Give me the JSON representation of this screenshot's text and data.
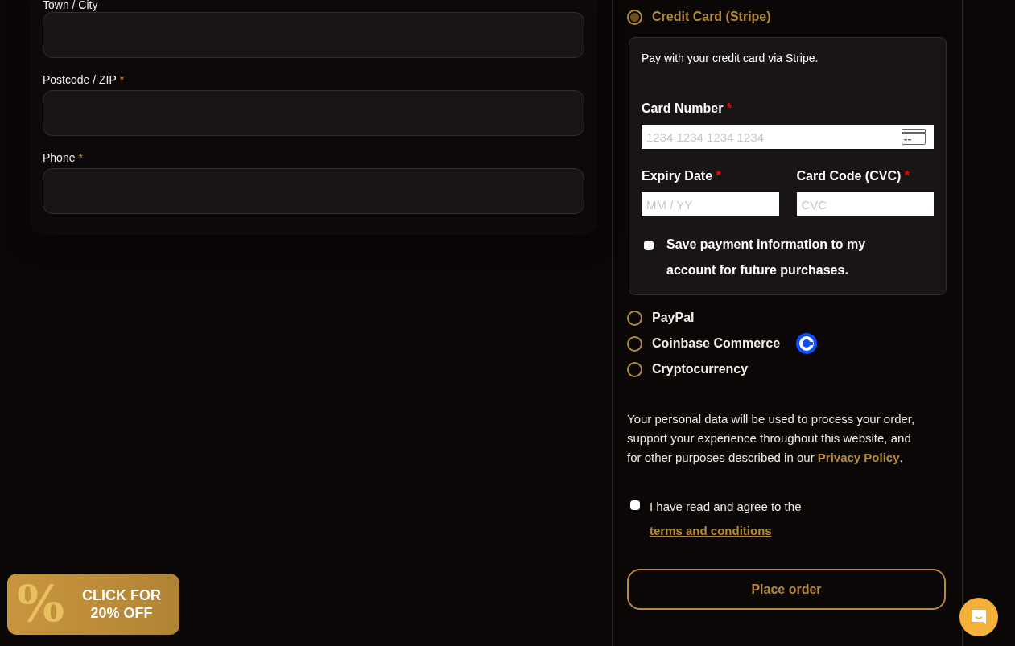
{
  "billing_fields": [
    {
      "label": "Town / City",
      "required": false
    },
    {
      "label": "Postcode / ZIP",
      "required": true
    },
    {
      "label": "Phone",
      "required": true
    }
  ],
  "payment_methods": [
    {
      "label": "Credit Card (Stripe)",
      "selected": true,
      "kind": "card"
    },
    {
      "label": "PayPal",
      "selected": false,
      "kind": "plain"
    },
    {
      "label": "Coinbase Commerce",
      "selected": false,
      "kind": "coinbase"
    },
    {
      "label": "Cryptocurrency",
      "selected": false,
      "kind": "plain"
    }
  ],
  "stripe_box": {
    "description": "Pay with your credit card via Stripe.",
    "card_number": {
      "label": "Card Number",
      "required_mark": "*",
      "placeholder": "1234 1234 1234 1234"
    },
    "expiry": {
      "label": "Expiry Date",
      "required_mark": "*",
      "placeholder": "MM / YY"
    },
    "cvc": {
      "label": "Card Code (CVC)",
      "required_mark": "*",
      "placeholder": "CVC"
    },
    "save_info": {
      "label": "Save payment information to my account for future purchases.",
      "checked": false
    }
  },
  "privacy_notice": {
    "text": "Your personal data will be used to process your order, support your experience throughout this website, and for other purposes described in our",
    "link": "Privacy Policy",
    "after": "."
  },
  "terms": {
    "text": "I have read and agree to the",
    "link": "terms and conditions",
    "checked": false
  },
  "place_order_button": "Place order",
  "promo": {
    "symbol": "%",
    "text": "CLICK FOR 20% OFF"
  }
}
